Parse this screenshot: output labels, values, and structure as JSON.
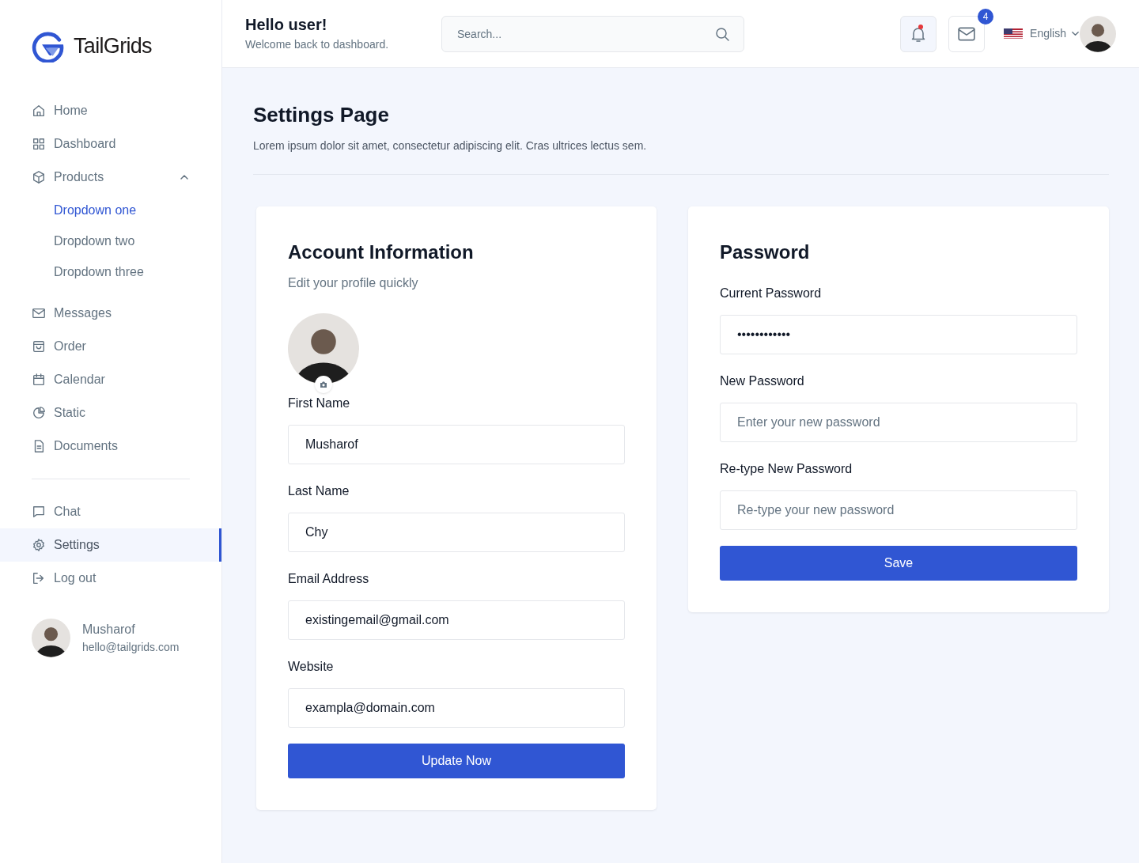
{
  "brand": {
    "name": "TailGrids"
  },
  "sidebar": {
    "items": [
      {
        "kind": "item",
        "label": "Home",
        "selected": false
      },
      {
        "kind": "item",
        "label": "Dashboard",
        "selected": false
      },
      {
        "kind": "group",
        "label": "Products",
        "selected": false,
        "expanded": true,
        "children": [
          {
            "label": "Dropdown one",
            "selected": true
          },
          {
            "label": "Dropdown two",
            "selected": false
          },
          {
            "label": "Dropdown three",
            "selected": false
          }
        ]
      },
      {
        "kind": "item",
        "label": "Messages",
        "selected": false
      },
      {
        "kind": "item",
        "label": "Order",
        "selected": false
      },
      {
        "kind": "item",
        "label": "Calendar",
        "selected": false
      },
      {
        "kind": "item",
        "label": "Static",
        "selected": false
      },
      {
        "kind": "item",
        "label": "Documents",
        "selected": false
      },
      {
        "kind": "divider"
      },
      {
        "kind": "item",
        "label": "Chat",
        "selected": false
      },
      {
        "kind": "item",
        "label": "Settings",
        "selected": true
      },
      {
        "kind": "item",
        "label": "Log out",
        "selected": false
      }
    ],
    "user": {
      "name": "Musharof",
      "email": "hello@tailgrids.com"
    }
  },
  "header": {
    "greeting": "Hello user!",
    "subtitle": "Welcome back to dashboard.",
    "search": {
      "placeholder": "Search..."
    },
    "notifications": {
      "unread": true
    },
    "messages": {
      "badge": "4"
    },
    "language": "English"
  },
  "page": {
    "title": "Settings Page",
    "description": "Lorem ipsum dolor sit amet, consectetur adipiscing elit. Cras ultrices lectus sem."
  },
  "account": {
    "title": "Account Information",
    "subtitle": "Edit your profile quickly",
    "fields": [
      {
        "label": "First Name",
        "value": "Musharof"
      },
      {
        "label": "Last Name",
        "value": "Chy"
      },
      {
        "label": "Email Address",
        "value": "existingemail@gmail.com"
      },
      {
        "label": "Website",
        "value": "exampla@domain.com"
      }
    ],
    "button": "Update Now"
  },
  "password": {
    "title": "Password",
    "fields": [
      {
        "label": "Current Password",
        "value": "••••••••••••"
      },
      {
        "label": "New Password",
        "placeholder": "Enter your new password"
      },
      {
        "label": "Re-type New Password",
        "placeholder": "Re-type your new password"
      }
    ],
    "button": "Save"
  }
}
